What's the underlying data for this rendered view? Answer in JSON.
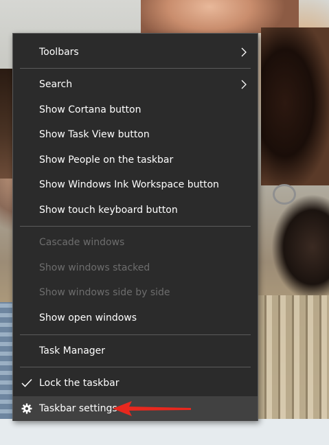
{
  "menu": {
    "items": [
      {
        "label": "Toolbars",
        "submenu": true,
        "enabled": true
      },
      {
        "label": "Search",
        "submenu": true,
        "enabled": true
      },
      {
        "label": "Show Cortana button",
        "enabled": true
      },
      {
        "label": "Show Task View button",
        "enabled": true
      },
      {
        "label": "Show People on the taskbar",
        "enabled": true
      },
      {
        "label": "Show Windows Ink Workspace button",
        "enabled": true
      },
      {
        "label": "Show touch keyboard button",
        "enabled": true
      },
      {
        "label": "Cascade windows",
        "enabled": false
      },
      {
        "label": "Show windows stacked",
        "enabled": false
      },
      {
        "label": "Show windows side by side",
        "enabled": false
      },
      {
        "label": "Show open windows",
        "enabled": true
      },
      {
        "label": "Task Manager",
        "enabled": true
      },
      {
        "label": "Lock the taskbar",
        "enabled": true,
        "checked": true,
        "icon": "check-icon"
      },
      {
        "label": "Taskbar settings",
        "enabled": true,
        "highlighted": true,
        "icon": "gear-icon"
      }
    ]
  },
  "colors": {
    "menu_background": "#2b2b2b",
    "menu_text": "#ffffff",
    "disabled_text": "#6d6d6d",
    "hover_background": "#414141",
    "separator": "#5c5c5c",
    "annotation_arrow": "#e8281e"
  },
  "annotation": {
    "icon": "red-arrow-icon",
    "points_to": "Taskbar settings"
  }
}
